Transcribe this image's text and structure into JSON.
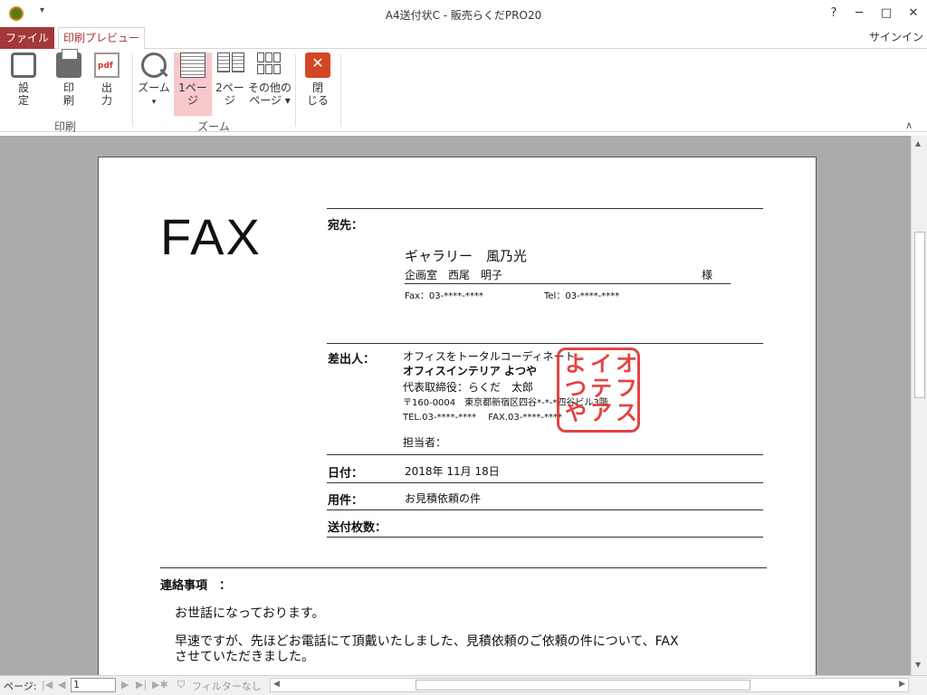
{
  "window": {
    "title": "A4送付状C - 販売らくだPRO20",
    "qat_label": "▾",
    "help": "?",
    "minimize": "─",
    "restore": "□",
    "close": "✕"
  },
  "tabs": {
    "file": "ファイル",
    "print_preview": "印刷プレビュー",
    "signin": "サインイン"
  },
  "ribbon": {
    "settings": "設\n定",
    "print": "印\n刷",
    "output": "出\n力",
    "pdf_badge": "pdf",
    "zoom": "ズーム",
    "zoom_arrow": "▾",
    "one_page": "1ペー\nジ",
    "two_page": "2ペー\nジ",
    "other_pages": "その他の\nページ ▾",
    "close": "閉\nじる",
    "close_glyph": "✕",
    "group_print": "印刷",
    "group_zoom": "ズーム",
    "collapse": "∧"
  },
  "document": {
    "fax": "FAX",
    "to_label": "宛先：",
    "to_company": "ギャラリー　風乃光",
    "to_person": "企画室　西尾　明子",
    "to_honorific": "様",
    "to_fax": "Fax：03-****-****",
    "to_tel": "Tel：03-****-****",
    "from_label": "差出人：",
    "from_tagline": "オフィスをトータルコーディネート",
    "from_company": "オフィスインテリア よつや",
    "from_rep": "代表取締役：らくだ　太郎",
    "from_address": "〒160-0004　東京都新宿区四谷*-*-*四谷ビル3階",
    "from_telfax": "TEL.03-****-****　 FAX.03-****-****",
    "from_staff": "担当者：",
    "seal_col1": "オ\nフ\nス",
    "seal_col2": "イ\nテ\nア",
    "seal_col3": "よ\nつ\nや",
    "date_label": "日付：",
    "date_value": "2018年 11月 18日",
    "subject_label": "用件：",
    "subject_value": "お見積依頼の件",
    "pages_label": "送付枚数：",
    "notes_label": "連絡事項　：",
    "notes_line1": "お世話になっております。",
    "notes_line2": "早速ですが、先ほどお電話にて頂戴いたしました、見積依頼のご依頼の件について、FAX",
    "notes_line3": "させていただきました。"
  },
  "status": {
    "page_label": "ページ:",
    "first": "|◀",
    "prev": "◀",
    "page_value": "1",
    "next": "▶",
    "last": "▶|",
    "new": "▶✱",
    "filter": "フィルターなし",
    "scroll_left": "◀",
    "scroll_right": "▶",
    "scroll_up": "▲",
    "scroll_down": "▼"
  }
}
